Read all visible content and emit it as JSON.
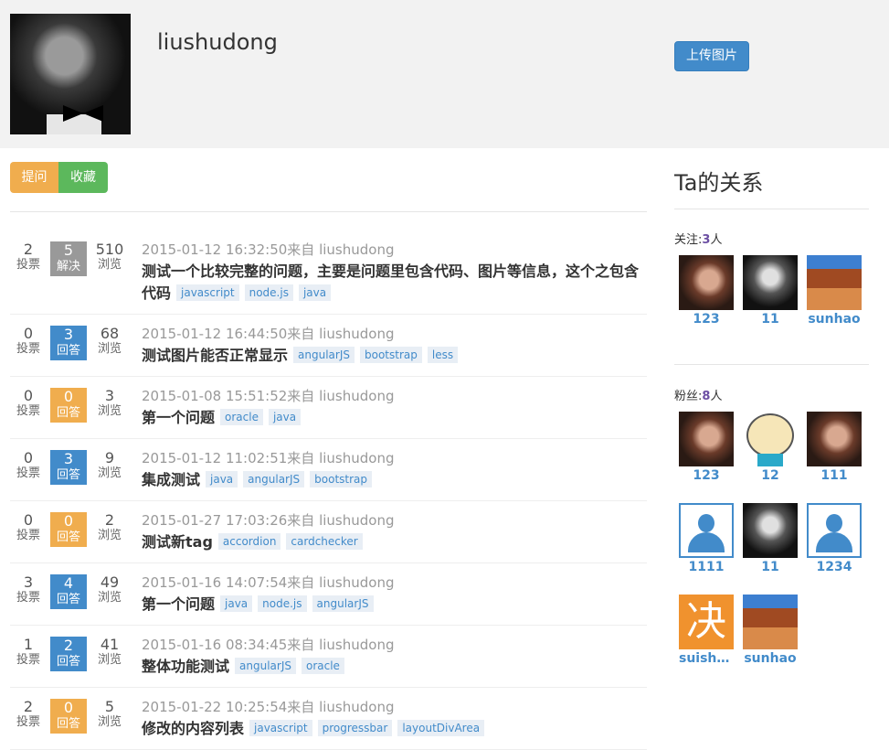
{
  "profile": {
    "username": "liushudong",
    "upload_label": "上传图片"
  },
  "tabs": {
    "ask": "提问",
    "favorite": "收藏"
  },
  "stat_labels": {
    "votes": "投票",
    "views": "浏览"
  },
  "questions": [
    {
      "votes": "2",
      "answers": "5",
      "answer_label": "解决",
      "status": "solved",
      "views": "510",
      "meta": "2015-01-12 16:32:50来自 liushudong",
      "title": "测试一个比较完整的问题，主要是问题里包含代码、图片等信息，这个之包含代码",
      "tags": [
        "javascript",
        "node.js",
        "java"
      ]
    },
    {
      "votes": "0",
      "answers": "3",
      "answer_label": "回答",
      "status": "answered",
      "views": "68",
      "meta": "2015-01-12 16:44:50来自 liushudong",
      "title": "测试图片能否正常显示",
      "tags": [
        "angularJS",
        "bootstrap",
        "less"
      ]
    },
    {
      "votes": "0",
      "answers": "0",
      "answer_label": "回答",
      "status": "none",
      "views": "3",
      "meta": "2015-01-08 15:51:52来自 liushudong",
      "title": "第一个问题",
      "tags": [
        "oracle",
        "java"
      ]
    },
    {
      "votes": "0",
      "answers": "3",
      "answer_label": "回答",
      "status": "answered",
      "views": "9",
      "meta": "2015-01-12 11:02:51来自 liushudong",
      "title": "集成测试",
      "tags": [
        "java",
        "angularJS",
        "bootstrap"
      ]
    },
    {
      "votes": "0",
      "answers": "0",
      "answer_label": "回答",
      "status": "none",
      "views": "2",
      "meta": "2015-01-27 17:03:26来自 liushudong",
      "title": "测试新tag",
      "tags": [
        "accordion",
        "cardchecker"
      ]
    },
    {
      "votes": "3",
      "answers": "4",
      "answer_label": "回答",
      "status": "answered",
      "views": "49",
      "meta": "2015-01-16 14:07:54来自 liushudong",
      "title": "第一个问题",
      "tags": [
        "java",
        "node.js",
        "angularJS"
      ]
    },
    {
      "votes": "1",
      "answers": "2",
      "answer_label": "回答",
      "status": "answered",
      "views": "41",
      "meta": "2015-01-16 08:34:45来自 liushudong",
      "title": "整体功能测试",
      "tags": [
        "angularJS",
        "oracle"
      ]
    },
    {
      "votes": "2",
      "answers": "0",
      "answer_label": "回答",
      "status": "none",
      "views": "5",
      "meta": "2015-01-22 10:25:54来自 liushudong",
      "title": "修改的内容列表",
      "tags": [
        "javascript",
        "progressbar",
        "layoutDivArea"
      ]
    }
  ],
  "sidebar": {
    "title": "Ta的关系",
    "following": {
      "label": "关注:",
      "count": "3",
      "unit": "人",
      "users": [
        {
          "name": "123",
          "pic": "woman"
        },
        {
          "name": "11",
          "pic": "bw"
        },
        {
          "name": "sunhao",
          "pic": "desert"
        }
      ]
    },
    "followers": {
      "label": "粉丝:",
      "count": "8",
      "unit": "人",
      "users": [
        {
          "name": "123",
          "pic": "woman"
        },
        {
          "name": "12",
          "pic": "face"
        },
        {
          "name": "111",
          "pic": "woman"
        },
        {
          "name": "1111",
          "pic": "user"
        },
        {
          "name": "11",
          "pic": "bw"
        },
        {
          "name": "1234",
          "pic": "user"
        },
        {
          "name": "suishi...",
          "pic": "jue",
          "glyph": "决"
        },
        {
          "name": "sunhao",
          "pic": "desert"
        }
      ]
    }
  }
}
